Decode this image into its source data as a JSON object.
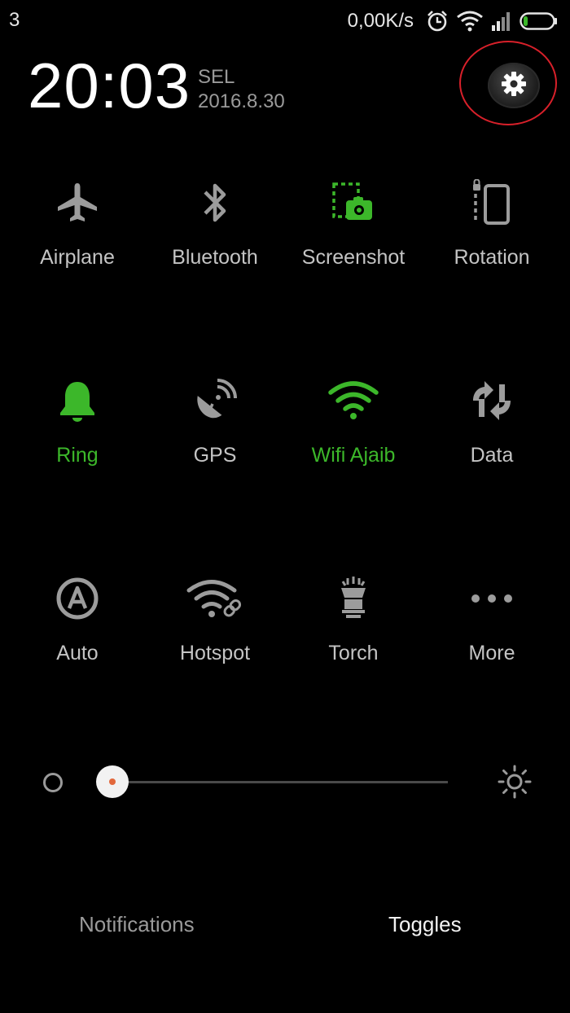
{
  "status_bar": {
    "left_indicator": "3",
    "net_speed": "0,00K/s",
    "icons": [
      "alarm-icon",
      "wifi-icon",
      "signal-icon",
      "battery-icon"
    ]
  },
  "header": {
    "time": "20:03",
    "day": "SEL",
    "date": "2016.8.30"
  },
  "toggles": {
    "airplane": {
      "label": "Airplane",
      "icon": "airplane-icon",
      "active": false
    },
    "bluetooth": {
      "label": "Bluetooth",
      "icon": "bluetooth-icon",
      "active": false
    },
    "screenshot": {
      "label": "Screenshot",
      "icon": "screenshot-icon",
      "active": false
    },
    "rotation": {
      "label": "Rotation",
      "icon": "rotation-icon",
      "active": false
    },
    "ring": {
      "label": "Ring",
      "icon": "bell-icon",
      "active": true
    },
    "gps": {
      "label": "GPS",
      "icon": "gps-icon",
      "active": false
    },
    "wifi": {
      "label": "Wifi Ajaib",
      "icon": "wifi-icon",
      "active": true
    },
    "data": {
      "label": "Data",
      "icon": "data-icon",
      "active": false
    },
    "auto": {
      "label": "Auto",
      "icon": "auto-brightness-icon",
      "active": false
    },
    "hotspot": {
      "label": "Hotspot",
      "icon": "hotspot-icon",
      "active": false
    },
    "torch": {
      "label": "Torch",
      "icon": "torch-icon",
      "active": false
    },
    "more": {
      "label": "More",
      "icon": "more-icon",
      "active": false
    }
  },
  "brightness": {
    "level_fraction": 0.0
  },
  "tabs": {
    "notifications": "Notifications",
    "toggles": "Toggles",
    "selected": "Toggles"
  },
  "colors": {
    "background": "#000000",
    "active_green": "#3cb72a",
    "inactive_gray": "#c4c4c4",
    "highlight_ring": "#d8202a",
    "slider_dot": "#e2683c"
  }
}
